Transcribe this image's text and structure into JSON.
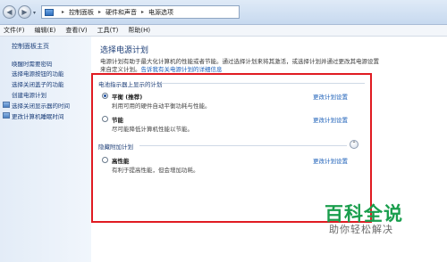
{
  "address": {
    "crumbs": [
      "控制面板",
      "硬件和声音",
      "电源选项"
    ],
    "dropdown_glyph": "▾"
  },
  "menu": [
    "文件(F)",
    "编辑(E)",
    "查看(V)",
    "工具(T)",
    "帮助(H)"
  ],
  "sidebar": {
    "home": "控制面板主页",
    "links": [
      "唤醒时需要密码",
      "选择电源按钮的功能",
      "选择关闭盖子的功能",
      "创建电源计划",
      "选择关闭显示器的时间",
      "更改计算机睡眠时间"
    ]
  },
  "main": {
    "title": "选择电源计划",
    "desc_line1": "电源计划有助于最大化计算机的性能或者节能。通过选择计划来将其激活，或选择计划并通过更改其电源设置",
    "desc_line2_prefix": "来自定义计划。",
    "desc_line2_link": "告诉我有关电源计划的详细信息"
  },
  "plans": {
    "battery_section": "电池指示器上显示的计划",
    "hidden_section": "隐藏附加计划",
    "change_label": "更改计划设置",
    "items": [
      {
        "name": "平衡 (推荐)",
        "desc": "利用可用的硬件自动平衡功耗与性能。",
        "selected": true
      },
      {
        "name": "节能",
        "desc": "尽可能降低计算机性能以节能。",
        "selected": false
      },
      {
        "name": "高性能",
        "desc": "有利于提高性能，但会增加功耗。",
        "selected": false
      }
    ],
    "collapse_glyph": "⌃"
  },
  "watermark": {
    "title": "百科全说",
    "subtitle": "助你轻松解决"
  },
  "colors": {
    "highlight_box": "#e01b22",
    "link": "#1b5fb8",
    "watermark_green": "#1a9e4d"
  }
}
